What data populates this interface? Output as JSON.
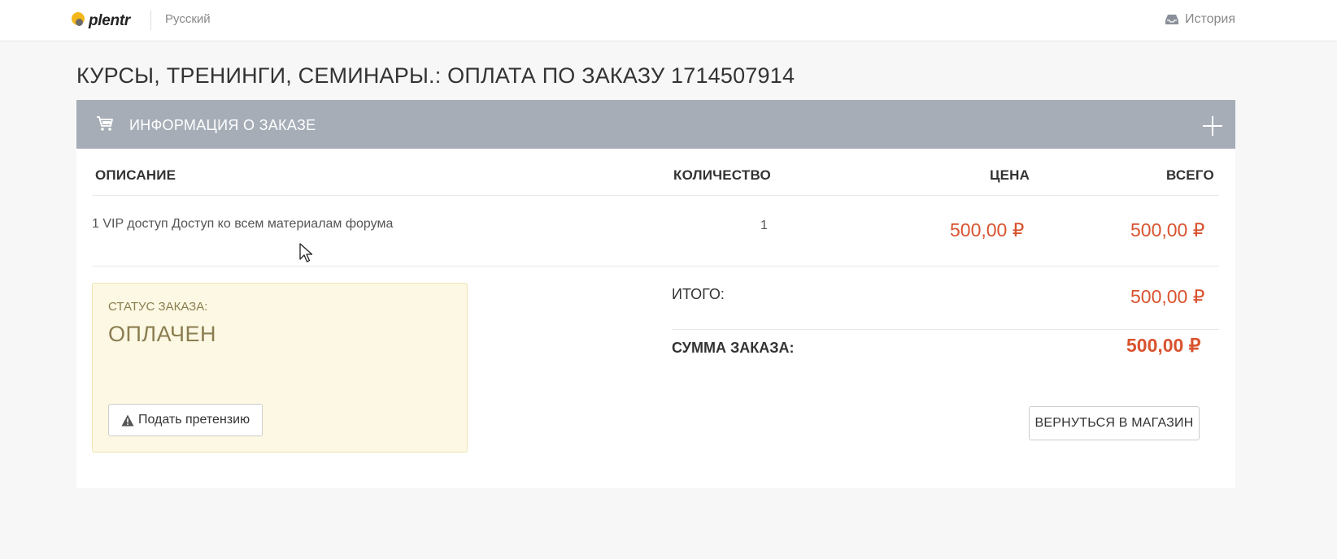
{
  "header": {
    "logo_text": "plentr",
    "language": "Русский",
    "history_label": "История"
  },
  "page": {
    "title": "КУРСЫ, ТРЕНИНГИ, СЕМИНАРЫ.: ОПЛАТА ПО ЗАКАЗУ 1714507914"
  },
  "panel": {
    "title": "ИНФОРМАЦИЯ О ЗАКАЗЕ",
    "columns": {
      "description": "ОПИСАНИЕ",
      "quantity": "КОЛИЧЕСТВО",
      "price": "ЦЕНА",
      "total": "ВСЕГО"
    },
    "rows": [
      {
        "description": "1 VIP доступ Доступ ко всем материалам форума",
        "quantity": "1",
        "price": "500,00 ₽",
        "total": "500,00 ₽"
      }
    ]
  },
  "status": {
    "label": "СТАТУС ЗАКАЗА:",
    "value": "ОПЛАЧЕН",
    "claim_button": "Подать претензию"
  },
  "totals": {
    "subtotal_label": "ИТОГО:",
    "subtotal_value": "500,00 ₽",
    "sum_label": "СУММА ЗАКАЗА:",
    "sum_value": "500,00 ₽",
    "back_button": "ВЕРНУТЬСЯ В МАГАЗИН"
  },
  "colors": {
    "accent_price": "#d9532f",
    "panel_header": "#a6adb7",
    "status_bg": "#fcf8e3"
  },
  "icons": [
    "inbox-icon",
    "cart-icon",
    "plus-icon",
    "warning-icon",
    "mouse-cursor-icon"
  ]
}
